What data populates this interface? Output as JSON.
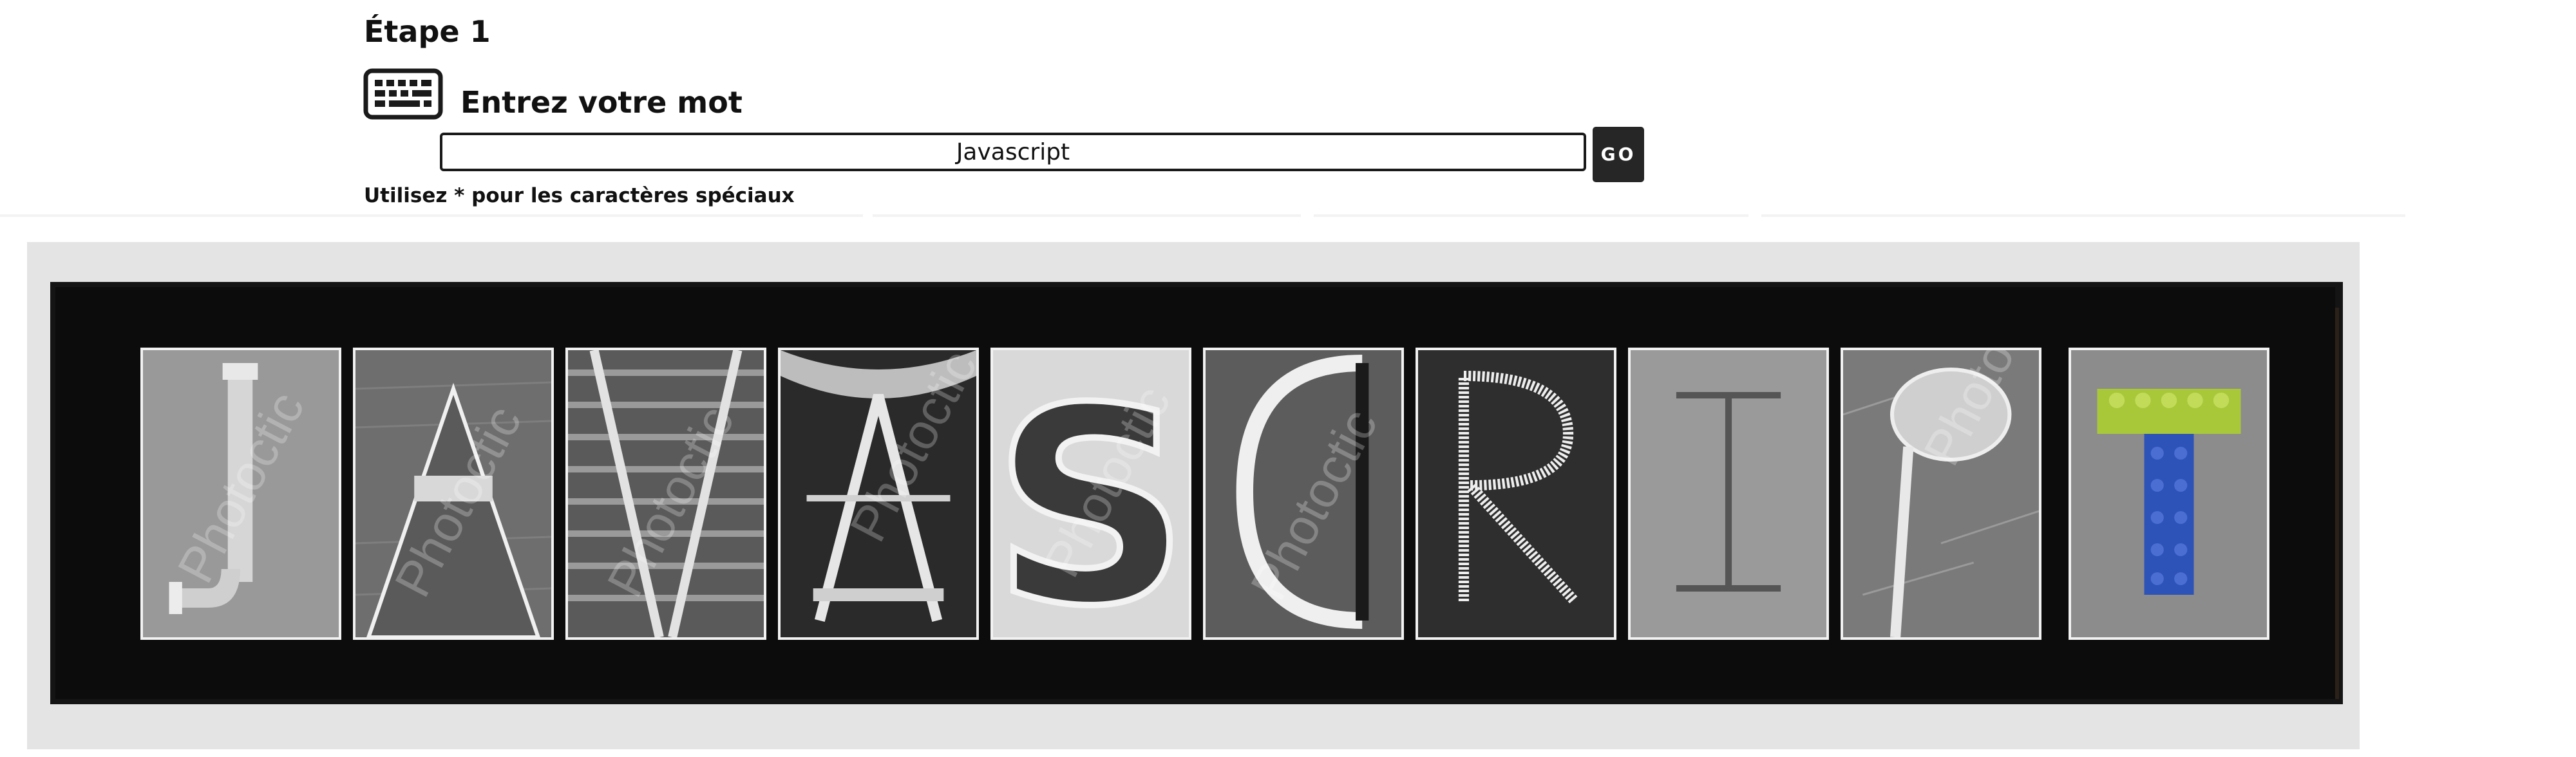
{
  "step": {
    "title": "Étape 1"
  },
  "input_section": {
    "icon": "keyboard-icon",
    "prompt": "Entrez votre mot",
    "word_value": "Javascript",
    "go_label": "GO",
    "hint": "Utilisez * pour les caractères spéciaux"
  },
  "preview": {
    "letters": [
      "J",
      "A",
      "V",
      "A",
      "S",
      "C",
      "R",
      "I",
      "P",
      "T"
    ],
    "watermark": "Photoctic",
    "colors": {
      "frame": "#e4e4e4",
      "mat": "#0c0c0c",
      "lego_green": "#a8c83a",
      "lego_blue": "#2d52b8"
    }
  }
}
